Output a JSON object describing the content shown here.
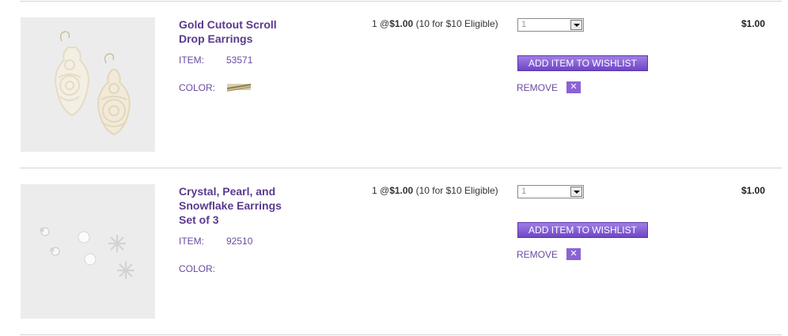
{
  "items": [
    {
      "name": "Gold Cutout Scroll Drop Earrings",
      "item_label": "ITEM:",
      "item_number": "53571",
      "color_label": "COLOR:",
      "price_qty": "1 @",
      "price": "$1.00",
      "promo": "(10 for $10 Eligible)",
      "quantity": "1",
      "wishlist_label": "ADD ITEM TO WISHLIST",
      "remove_label": "REMOVE",
      "remove_icon": "✕",
      "total": "$1.00"
    },
    {
      "name": "Crystal, Pearl, and Snowflake Earrings Set of 3",
      "item_label": "ITEM:",
      "item_number": "92510",
      "color_label": "COLOR:",
      "price_qty": "1 @",
      "price": "$1.00",
      "promo": "(10 for $10 Eligible)",
      "quantity": "1",
      "wishlist_label": "ADD ITEM TO WISHLIST",
      "remove_label": "REMOVE",
      "remove_icon": "✕",
      "total": "$1.00"
    }
  ],
  "colors": {
    "accent": "#6b4aa0",
    "button": "#7b55d0"
  }
}
